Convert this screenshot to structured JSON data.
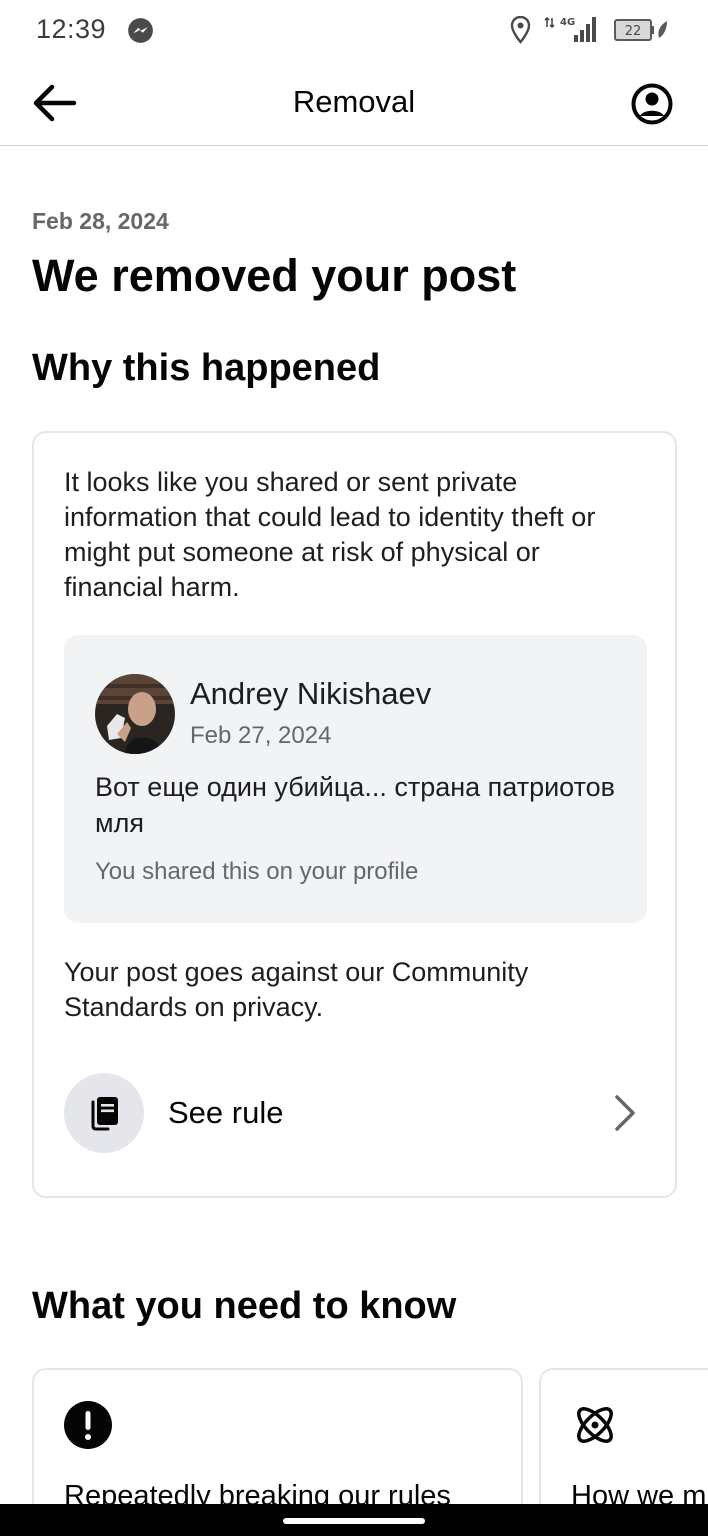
{
  "status_bar": {
    "time": "12:39",
    "network": "4G",
    "battery": "22"
  },
  "header": {
    "title": "Removal"
  },
  "notice": {
    "date": "Feb 28, 2024",
    "title": "We removed your post"
  },
  "why_section": {
    "title": "Why this happened",
    "reason": "It looks like you shared or sent private information that could lead to identity theft or might put someone at risk of physical or financial harm.",
    "post": {
      "author": "Andrey Nikishaev",
      "date": "Feb 27, 2024",
      "text": "Вот еще один убийца... страна патриотов мля",
      "shared_note": "You shared this on your profile"
    },
    "standards": "Your post goes against our Community Standards on privacy.",
    "see_rule_label": "See rule"
  },
  "know_section": {
    "title": "What you need to know",
    "cards": [
      {
        "icon": "exclamation-icon",
        "text": "Repeatedly breaking our rules"
      },
      {
        "icon": "atom-icon",
        "text": "How we m"
      }
    ]
  },
  "colors": {
    "primary_text": "#050505",
    "secondary_text": "#65676b",
    "card_border": "#e4e6eb",
    "preview_bg": "#f2f3f5"
  }
}
